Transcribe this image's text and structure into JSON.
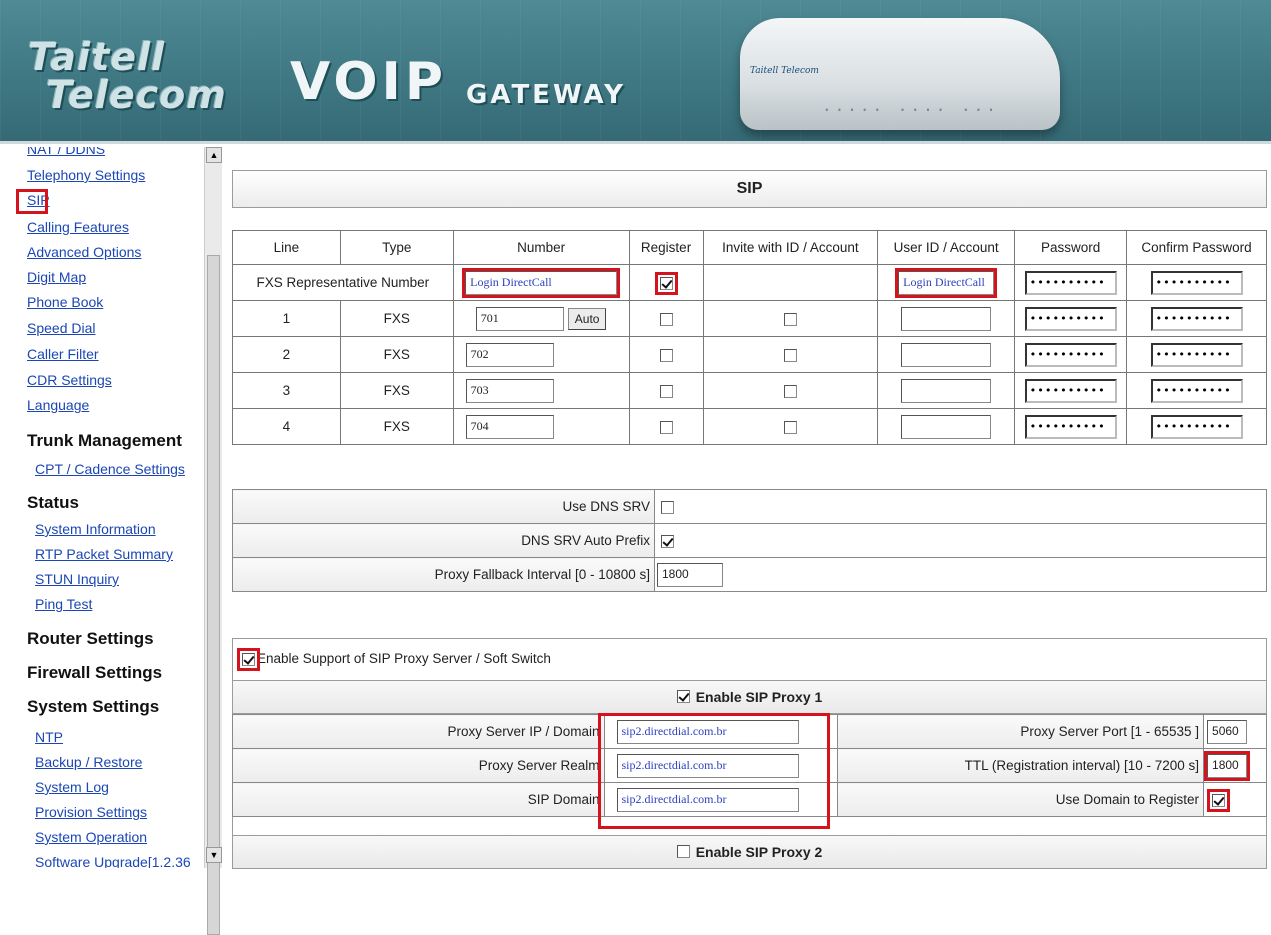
{
  "header": {
    "brand_line1": "Taitell",
    "brand_line2": "Telecom",
    "product": "VOIP",
    "product_sub": "GATEWAY",
    "device_label": "Taitell Telecom",
    "device_leds": "..... .... ..."
  },
  "sidebar": {
    "items": [
      {
        "label": "NAT / DDNS"
      },
      {
        "label": "Telephony Settings"
      },
      {
        "label": "SIP"
      },
      {
        "label": "Calling Features"
      },
      {
        "label": "Advanced Options"
      },
      {
        "label": "Digit Map"
      },
      {
        "label": "Phone Book"
      },
      {
        "label": "Speed Dial"
      },
      {
        "label": "Caller Filter"
      },
      {
        "label": "CDR Settings"
      },
      {
        "label": "Language"
      }
    ],
    "trunk_heading": "Trunk Management",
    "trunk_items": [
      {
        "label": "CPT / Cadence Settings"
      }
    ],
    "status_heading": "Status",
    "status_items": [
      {
        "label": "System Information"
      },
      {
        "label": "RTP Packet Summary"
      },
      {
        "label": "STUN Inquiry"
      },
      {
        "label": "Ping Test"
      }
    ],
    "router_heading": "Router Settings",
    "firewall_heading": "Firewall Settings",
    "system_heading": "System Settings",
    "system_items": [
      {
        "label": "NTP"
      },
      {
        "label": "Backup / Restore"
      },
      {
        "label": "System Log"
      },
      {
        "label": "Provision Settings"
      },
      {
        "label": "System Operation"
      },
      {
        "label": "Software Upgrade[1.2.36"
      }
    ],
    "scroll_up": "▲",
    "scroll_down": "▼"
  },
  "main": {
    "title": "SIP",
    "columns": [
      "Line",
      "Type",
      "Number",
      "Register",
      "Invite with ID / Account",
      "User ID / Account",
      "Password",
      "Confirm Password"
    ],
    "rep_label": "FXS Representative Number",
    "rep_number": "Login DirectCall",
    "rep_register_checked": true,
    "rep_user_id": "Login DirectCall",
    "password_mask": "••••••••••",
    "auto_label": "Auto",
    "lines": [
      {
        "line": "1",
        "type": "FXS",
        "number": "701",
        "register": false,
        "invite": false
      },
      {
        "line": "2",
        "type": "FXS",
        "number": "702",
        "register": false,
        "invite": false
      },
      {
        "line": "3",
        "type": "FXS",
        "number": "703",
        "register": false,
        "invite": false
      },
      {
        "line": "4",
        "type": "FXS",
        "number": "704",
        "register": false,
        "invite": false
      }
    ],
    "dns": {
      "use_dns_srv_label": "Use DNS SRV",
      "use_dns_srv": false,
      "auto_prefix_label": "DNS SRV Auto Prefix",
      "auto_prefix": true,
      "fallback_label": "Proxy Fallback Interval [0 - 10800 s]",
      "fallback_value": "1800"
    },
    "proxy": {
      "enable_support_label": "Enable Support of SIP Proxy Server / Soft Switch",
      "enable_support": true,
      "proxy1_label": "Enable SIP Proxy 1",
      "proxy1_enabled": true,
      "server_ip_label": "Proxy Server IP / Domain",
      "server_ip": "sip2.directdial.com.br",
      "realm_label": "Proxy Server Realm",
      "realm": "sip2.directdial.com.br",
      "sip_domain_label": "SIP Domain",
      "sip_domain": "sip2.directdial.com.br",
      "port_label": "Proxy Server Port [1 - 65535 ]",
      "port": "5060",
      "ttl_label": "TTL (Registration interval) [10 - 7200 s]",
      "ttl": "1800",
      "use_domain_label": "Use Domain to Register",
      "use_domain": true,
      "proxy2_label": "Enable SIP Proxy 2",
      "proxy2_enabled": false
    }
  },
  "colors": {
    "highlight_red": "#d4131d",
    "link_blue": "#1b46b5",
    "header_teal": "#3f7883"
  }
}
